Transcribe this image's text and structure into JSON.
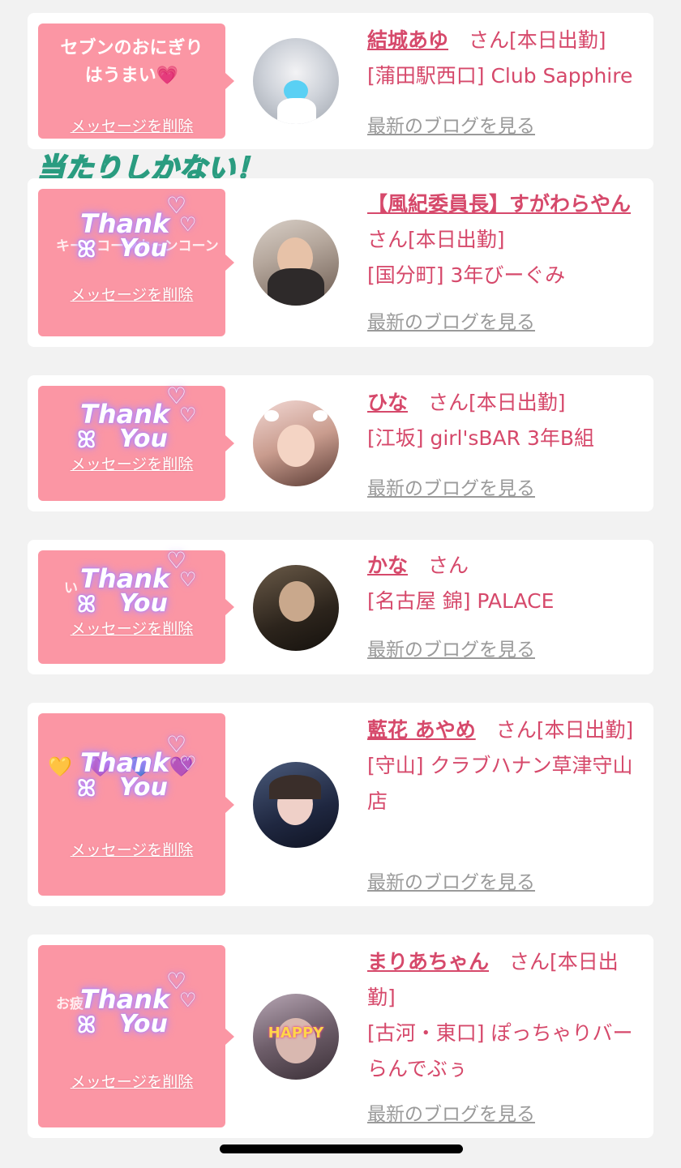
{
  "decoration": {
    "text": "当たりしかない！"
  },
  "cards": [
    {
      "bubble_text": "セブンのおにぎり\nはうまい💗",
      "delete_label": "メッセージを削除",
      "name": "結城あゆ",
      "suffix": "さん[本日出勤]",
      "shop": "[蒲田駅西口] Club Sapphire",
      "blog_label": "最新のブログを見る"
    },
    {
      "sticker": "Thank You",
      "faint_text": "キーンコーンカーンコーン🏢",
      "delete_label": "メッセージを削除",
      "name": "【風紀委員長】すがわらやん",
      "suffix": "さん[本日出勤]",
      "shop": "[国分町] 3年びーぐみ",
      "blog_label": "最新のブログを見る"
    },
    {
      "sticker": "Thank You",
      "delete_label": "メッセージを削除",
      "name": "ひな",
      "suffix": "さん[本日出勤]",
      "shop": "[江坂] girl'sBAR 3年B組",
      "blog_label": "最新のブログを見る"
    },
    {
      "sticker": "Thank You",
      "faint_text": "い",
      "delete_label": "メッセージを削除",
      "name": "かな",
      "suffix": "さん",
      "shop": "[名古屋 錦] PALACE",
      "blog_label": "最新のブログを見る"
    },
    {
      "sticker": "Thank You",
      "faint_text": "💛💜💙💜",
      "delete_label": "メッセージを削除",
      "name": "藍花 あやめ",
      "suffix": "さん[本日出勤]",
      "shop": "[守山] クラブハナン草津守山店",
      "blog_label": "最新のブログを見る"
    },
    {
      "sticker": "Thank You",
      "faint_text": "お疲",
      "delete_label": "メッセージを削除",
      "name": "まりあちゃん",
      "suffix": "さん[本日出勤]",
      "shop": "[古河・東口] ぽっちゃりバー らんでぶぅ",
      "blog_label": "最新のブログを見る",
      "avatar_text": "HAPPY"
    }
  ],
  "sticker_text": {
    "line1": "Thank",
    "line2": "You"
  }
}
